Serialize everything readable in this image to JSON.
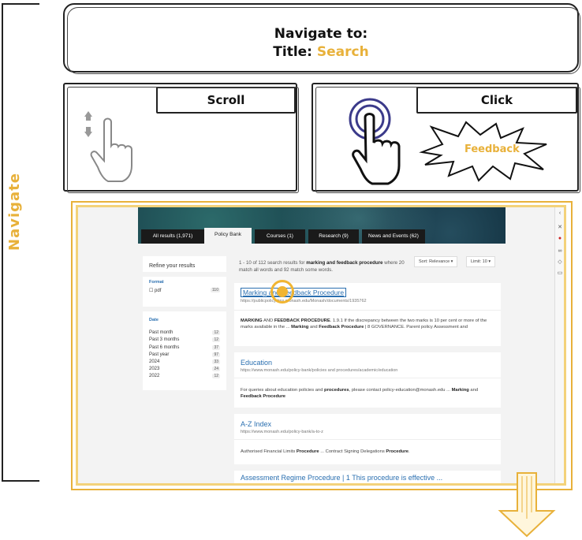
{
  "side_label": "Navigate",
  "header": {
    "line1": "Navigate to:",
    "title_prefix": "Title:",
    "title_value": "Search"
  },
  "scroll_panel": {
    "label": "Scroll"
  },
  "click_panel": {
    "label": "Click",
    "target": "Feedback"
  },
  "accent_color": "#e8b13a",
  "screenshot": {
    "tabs": [
      "All results (1,971)",
      "Policy Bank",
      "Courses (1)",
      "Research (9)",
      "News and Events (62)"
    ],
    "active_tab": "Policy Bank",
    "refine": "Refine your results",
    "facets": {
      "format": {
        "heading": "Format",
        "items": [
          {
            "label": "☐ pdf",
            "count": "110"
          }
        ]
      },
      "date": {
        "heading": "Date",
        "items": [
          {
            "label": "Past month",
            "count": "12"
          },
          {
            "label": "Past 3 months",
            "count": "12"
          },
          {
            "label": "Past 6 months",
            "count": "37"
          },
          {
            "label": "Past year",
            "count": "97"
          },
          {
            "label": "2024",
            "count": "33"
          },
          {
            "label": "2023",
            "count": "24"
          },
          {
            "label": "2022",
            "count": "12"
          }
        ]
      }
    },
    "summary": {
      "pre": "1 - 10 of 112 search results for ",
      "query": "marking and feedback procedure",
      "post": " where 20 match all words and 92 match some words."
    },
    "sort": {
      "relevance": "Sort: Relevance ▾",
      "limit": "Limit: 10 ▾"
    },
    "results": [
      {
        "title": "Marking and Feedback Procedure",
        "url": "https://publicpolicydms.monash.edu/Monash/documents/1935762",
        "snippet_a": "MARKING",
        "snippet_b": " AND ",
        "snippet_c": "FEEDBACK PROCEDURE",
        "snippet_d": ". 1.9.1 If the discrepancy between the two marks is 10 per cent or more of the marks available in the ... ",
        "snippet_e": "Marking",
        "snippet_f": " and ",
        "snippet_g": "Feedback Procedure",
        "snippet_h": " | 8 GOVERNANCE. Parent policy Assessment and"
      },
      {
        "title": "Education",
        "url": "https://www.monash.edu/policy-bank/policies and procedures/academic/education",
        "snippet_a": "For queries about education policies and ",
        "snippet_b": "procedures",
        "snippet_c": ", please contact policy-education@monash.edu ... ",
        "snippet_d": "Marking",
        "snippet_e": " and ",
        "snippet_f": "Feedback Procedure"
      },
      {
        "title": "A-Z Index",
        "url": "https://www.monash.edu/policy-bank/a-to-z",
        "snippet_a": "Authorised Financial Limits ",
        "snippet_b": "Procedure",
        "snippet_c": " ... Contract Signing Delegations ",
        "snippet_d": "Procedure",
        "snippet_e": "."
      },
      {
        "title": "Assessment Regime Procedure | 1 This procedure is effective ..."
      }
    ]
  }
}
